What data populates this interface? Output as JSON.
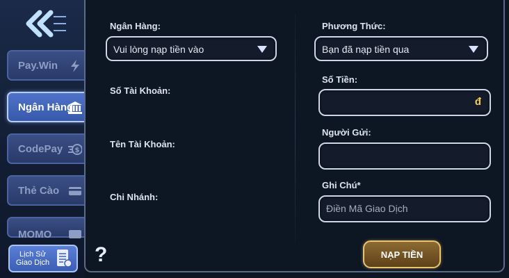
{
  "sidebar": {
    "tabs": [
      {
        "label": "Pay.Win",
        "icon": "lightning-icon"
      },
      {
        "label": "Ngân Hàng",
        "icon": "bank-icon",
        "active": true
      },
      {
        "label": "CodePay",
        "icon": "coins-icon"
      },
      {
        "label": "Thẻ Cào",
        "icon": "card-icon"
      },
      {
        "label": "MOMO",
        "icon": "wallet-icon"
      }
    ],
    "history_line1": "Lịch Sử",
    "history_line2": "Giao Dịch",
    "help": "?"
  },
  "form": {
    "bank_label": "Ngân Hàng:",
    "bank_value": "Vui lòng nạp tiền vào",
    "method_label": "Phương Thức:",
    "method_value": "Bạn đã nạp tiền qua",
    "account_number_label": "Số Tài Khoản:",
    "amount_label": "Số Tiền:",
    "currency_symbol": "đ",
    "account_name_label": "Tên Tài Khoản:",
    "sender_label": "Người Gửi:",
    "branch_label": "Chi Nhánh:",
    "note_label": "Ghi Chú*",
    "note_placeholder": "Điền Mã Giao Dịch",
    "submit_label": "NẠP TIỀN"
  },
  "colors": {
    "active_tab": "#3859ab",
    "submit_border": "#e8c570",
    "currency": "#f2cd56"
  }
}
